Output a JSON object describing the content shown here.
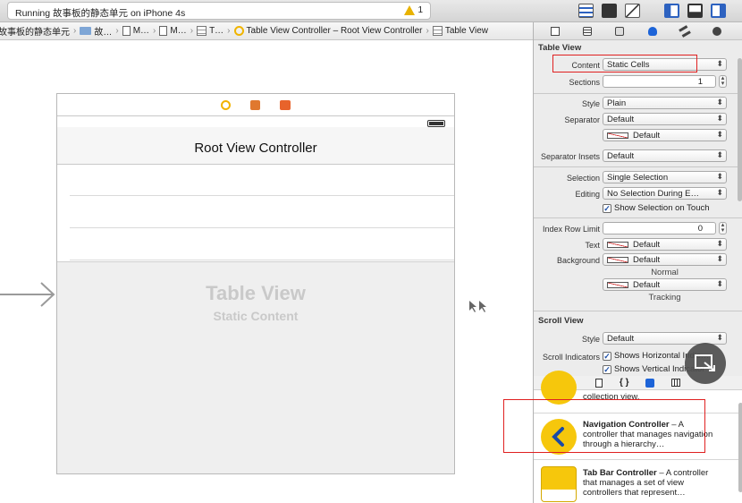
{
  "toolbar": {
    "status": "Running 故事板的静态单元 on iPhone 4s",
    "warning_count": "1"
  },
  "jumpbar": {
    "items": [
      "故事板的静态单元",
      "故…",
      "M…",
      "M…",
      "T…",
      "Table View Controller – Root View Controller",
      "Table View"
    ]
  },
  "canvas": {
    "nav_title": "Root View Controller",
    "placeholder_title": "Table View",
    "placeholder_subtitle": "Static Content"
  },
  "inspector": {
    "table_view": {
      "section_title": "Table View",
      "content_label": "Content",
      "content_value": "Static Cells",
      "sections_label": "Sections",
      "sections_value": "1",
      "style_label": "Style",
      "style_value": "Plain",
      "separator_label": "Separator",
      "separator_value": "Default",
      "separator_color_value": "Default",
      "separator_insets_label": "Separator Insets",
      "separator_insets_value": "Default",
      "selection_label": "Selection",
      "selection_value": "Single Selection",
      "editing_label": "Editing",
      "editing_value": "No Selection During E…",
      "show_selection_label": "Show Selection on Touch",
      "index_row_limit_label": "Index Row Limit",
      "index_row_limit_value": "0",
      "text_label": "Text",
      "text_value": "Default",
      "background_label": "Background",
      "background_value": "Default",
      "normal_label": "Normal",
      "tracking_value": "Default",
      "tracking_label": "Tracking"
    },
    "scroll_view": {
      "section_title": "Scroll View",
      "style_label": "Style",
      "style_value": "Default",
      "indicators_label": "Scroll Indicators",
      "horizontal_label": "Shows Horizontal Indic…",
      "vertical_label": "Shows Vertical Indicator"
    }
  },
  "library": {
    "items": [
      {
        "desc": "collection view."
      },
      {
        "title": "Navigation Controller",
        "desc": " – A controller that manages navigation through a hierarchy…"
      },
      {
        "title": "Tab Bar Controller",
        "desc": " – A controller that manages a set of view controllers that represent…"
      }
    ]
  },
  "colors": {
    "highlight": "#e02020",
    "accent": "#1d4fa8",
    "library_icon": "#f6c70c"
  }
}
